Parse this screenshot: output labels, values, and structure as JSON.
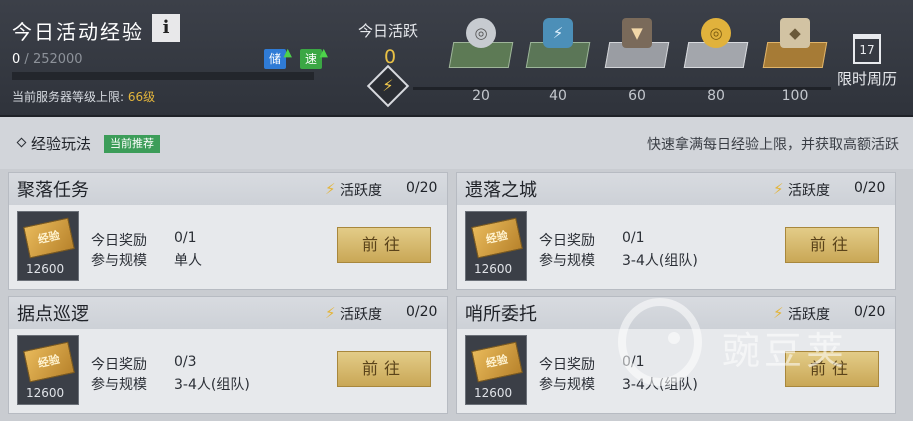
{
  "header": {
    "exp_title": "今日活动经验",
    "info_label": "i",
    "exp_current": "0",
    "exp_separator": " / ",
    "exp_max": "252000",
    "exp_progress": 0,
    "badge_store": "储",
    "badge_speed": "速",
    "server_limit_prefix": "当前服务器等级上限: ",
    "server_limit_level": "66级",
    "daily_active_label": "今日活跃",
    "daily_active_value": "0",
    "milestones": [
      {
        "value": "20",
        "icon": "silver-coin-chest-icon"
      },
      {
        "value": "40",
        "icon": "energy-chest-icon"
      },
      {
        "value": "60",
        "icon": "emblem-chest-icon"
      },
      {
        "value": "80",
        "icon": "gold-coin-chest-icon"
      },
      {
        "value": "100",
        "icon": "gold-ore-chest-icon"
      }
    ],
    "limited_week_day": "17",
    "limited_week_label": "限时周历"
  },
  "section": {
    "title": "经验玩法",
    "tag": "当前推荐",
    "description": "快速拿满每日经验上限，并获取高额活跃"
  },
  "cards": [
    {
      "title": "聚落任务",
      "activity_label": "活跃度",
      "activity_value": "0/20",
      "ticket_text": "经验",
      "ticket_amount": "12600",
      "reward_label": "今日奖励",
      "reward_value": "0/1",
      "scale_label": "参与规模",
      "scale_value": "单人",
      "button": "前往"
    },
    {
      "title": "遗落之城",
      "activity_label": "活跃度",
      "activity_value": "0/20",
      "ticket_text": "经验",
      "ticket_amount": "12600",
      "reward_label": "今日奖励",
      "reward_value": "0/1",
      "scale_label": "参与规模",
      "scale_value": "3-4人(组队)",
      "button": "前往"
    },
    {
      "title": "据点巡逻",
      "activity_label": "活跃度",
      "activity_value": "0/20",
      "ticket_text": "经验",
      "ticket_amount": "12600",
      "reward_label": "今日奖励",
      "reward_value": "0/3",
      "scale_label": "参与规模",
      "scale_value": "3-4人(组队)",
      "button": "前往"
    },
    {
      "title": "哨所委托",
      "activity_label": "活跃度",
      "activity_value": "0/20",
      "ticket_text": "经验",
      "ticket_amount": "12600",
      "reward_label": "今日奖励",
      "reward_value": "0/1",
      "scale_label": "参与规模",
      "scale_value": "3-4人(组队)",
      "button": "前往"
    }
  ],
  "watermark": {
    "text": "豌豆荚"
  },
  "colors": {
    "accent_gold": "#e3b53c",
    "button_gold": "#c9a756",
    "tag_green": "#3c9d59",
    "header_bg": "#343841"
  }
}
